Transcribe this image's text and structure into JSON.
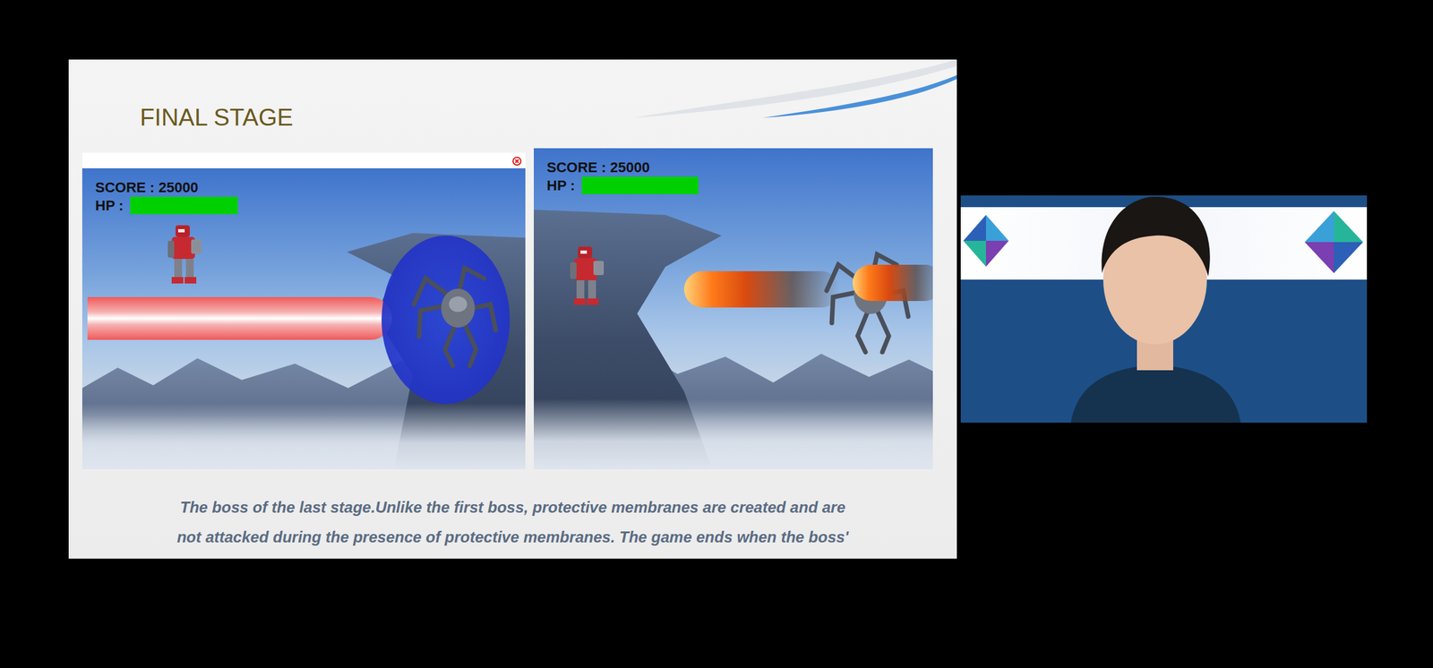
{
  "slide": {
    "title": "FINAL STAGE",
    "screens": [
      {
        "score": "SCORE : 25000",
        "hp_label": "HP :",
        "hp": {
          "level": 1
        }
      },
      {
        "score": "SCORE : 25000",
        "hp_label": "HP :",
        "hp": {
          "level": 1
        }
      }
    ],
    "caption": [
      "The boss of the last stage.Unlike the first boss, protective membranes are created and are",
      "not attacked during the presence of protective membranes. The game ends when the boss'"
    ]
  }
}
